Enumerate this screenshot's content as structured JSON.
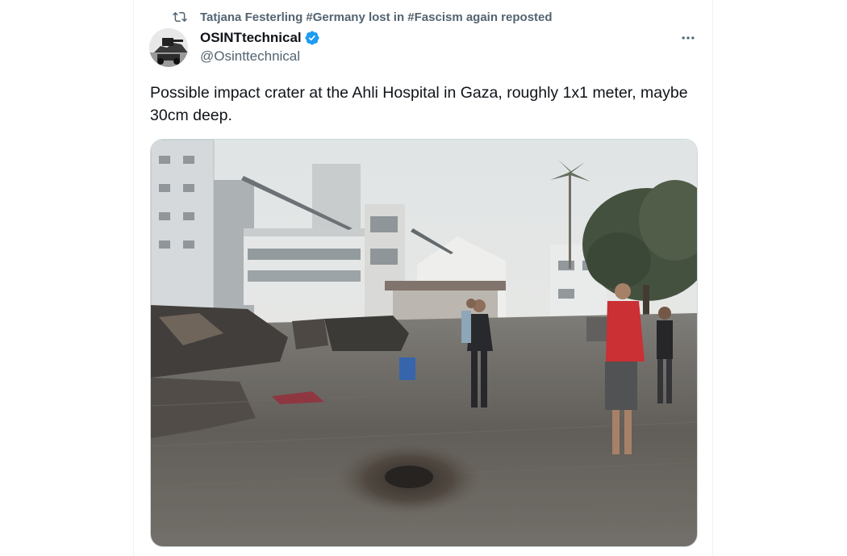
{
  "repost": {
    "icon": "repost-icon",
    "text": "Tatjana Festerling #Germany lost in #Fascism again reposted"
  },
  "author": {
    "display_name": "OSINTtechnical",
    "handle": "@Osinttechnical",
    "verified_icon": "verified-badge-icon",
    "verified_color": "#1d9bf0",
    "avatar_icon": "avatar-image"
  },
  "more_icon": "more-horizontal-icon",
  "tweet": {
    "text": "Possible impact crater at the Ahli Hospital in Gaza, roughly 1x1 meter, maybe 30cm deep."
  },
  "media": {
    "kind": "photo"
  },
  "colors": {
    "primary_text": "#0f1419",
    "secondary_text": "#536471",
    "border": "#eff3f4",
    "accent": "#1d9bf0"
  }
}
